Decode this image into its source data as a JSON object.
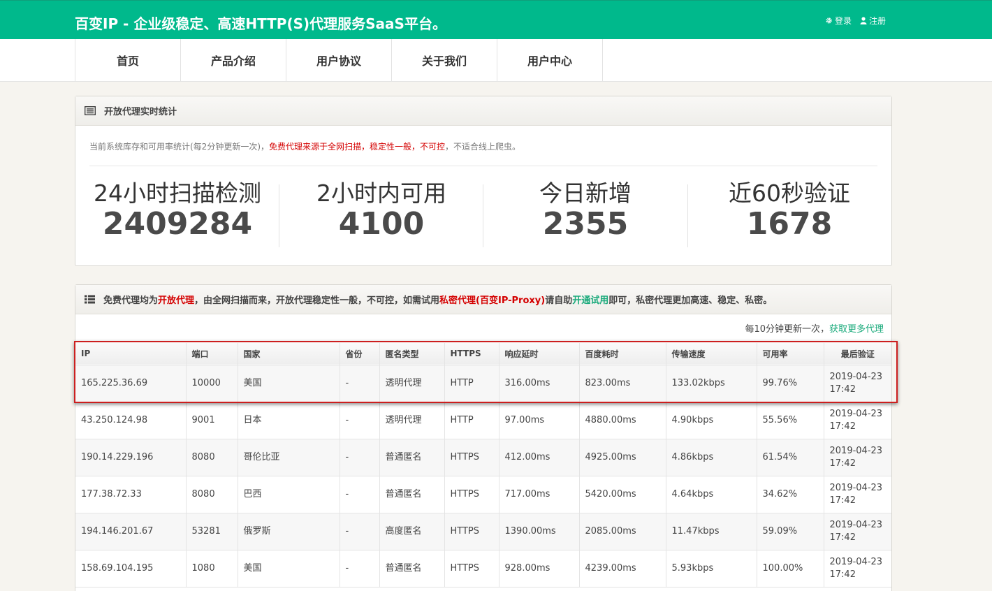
{
  "header": {
    "brand": "百变IP - 企业级稳定、高速HTTP(S)代理服务SaaS平台。",
    "login": "登录",
    "register": "注册"
  },
  "nav": [
    "首页",
    "产品介绍",
    "用户协议",
    "关于我们",
    "用户中心"
  ],
  "stats_panel": {
    "title": "开放代理实时统计",
    "note_gray1": "当前系统库存和可用率统计(每2分钟更新一次)，",
    "note_red": "免费代理来源于全网扫描，稳定性一般，不可控",
    "note_gray2": "，不适合线上爬虫。",
    "stats": [
      {
        "label": "24小时扫描检测",
        "value": "2409284"
      },
      {
        "label": "2小时内可用",
        "value": "4100"
      },
      {
        "label": "今日新增",
        "value": "2355"
      },
      {
        "label": "近60秒验证",
        "value": "1678"
      }
    ]
  },
  "proxy_panel": {
    "head_a": "免费代理均为",
    "head_b": "开放代理",
    "head_c": "，由全网扫描而来，开放代理稳定性一般，不可控，如需试用",
    "head_d": "私密代理(百变IP-Proxy)",
    "head_e": "请自助",
    "head_f": "开通试用",
    "head_g": "即可，私密代理更加高速、稳定、私密。",
    "update_text": "每10分钟更新一次，",
    "update_link": "获取更多代理",
    "columns": [
      "IP",
      "端口",
      "国家",
      "省份",
      "匿名类型",
      "HTTPS",
      "响应延时",
      "百度耗时",
      "传输速度",
      "可用率",
      "最后验证"
    ],
    "rows": [
      [
        "165.225.36.69",
        "10000",
        "美国",
        "-",
        "透明代理",
        "HTTP",
        "316.00ms",
        "823.00ms",
        "133.02kbps",
        "99.76%",
        "2019-04-23 17:42"
      ],
      [
        "43.250.124.98",
        "9001",
        "日本",
        "-",
        "透明代理",
        "HTTP",
        "97.00ms",
        "4880.00ms",
        "4.90kbps",
        "55.56%",
        "2019-04-23 17:42"
      ],
      [
        "190.14.229.196",
        "8080",
        "哥伦比亚",
        "-",
        "普通匿名",
        "HTTPS",
        "412.00ms",
        "4925.00ms",
        "4.86kbps",
        "61.54%",
        "2019-04-23 17:42"
      ],
      [
        "177.38.72.33",
        "8080",
        "巴西",
        "-",
        "普通匿名",
        "HTTPS",
        "717.00ms",
        "5420.00ms",
        "4.64kbps",
        "34.62%",
        "2019-04-23 17:42"
      ],
      [
        "194.146.201.67",
        "53281",
        "俄罗斯",
        "-",
        "高度匿名",
        "HTTPS",
        "1390.00ms",
        "2085.00ms",
        "11.47kbps",
        "59.09%",
        "2019-04-23 17:42"
      ],
      [
        "158.69.104.195",
        "1080",
        "美国",
        "-",
        "普通匿名",
        "HTTPS",
        "928.00ms",
        "4239.00ms",
        "5.93kbps",
        "100.00%",
        "2019-04-23 17:42"
      ]
    ]
  },
  "colors": {
    "brand_green": "#00b98c",
    "accent_red": "#d40000",
    "link_green": "#1aaa7b",
    "highlight_red": "#cc1f1f"
  }
}
